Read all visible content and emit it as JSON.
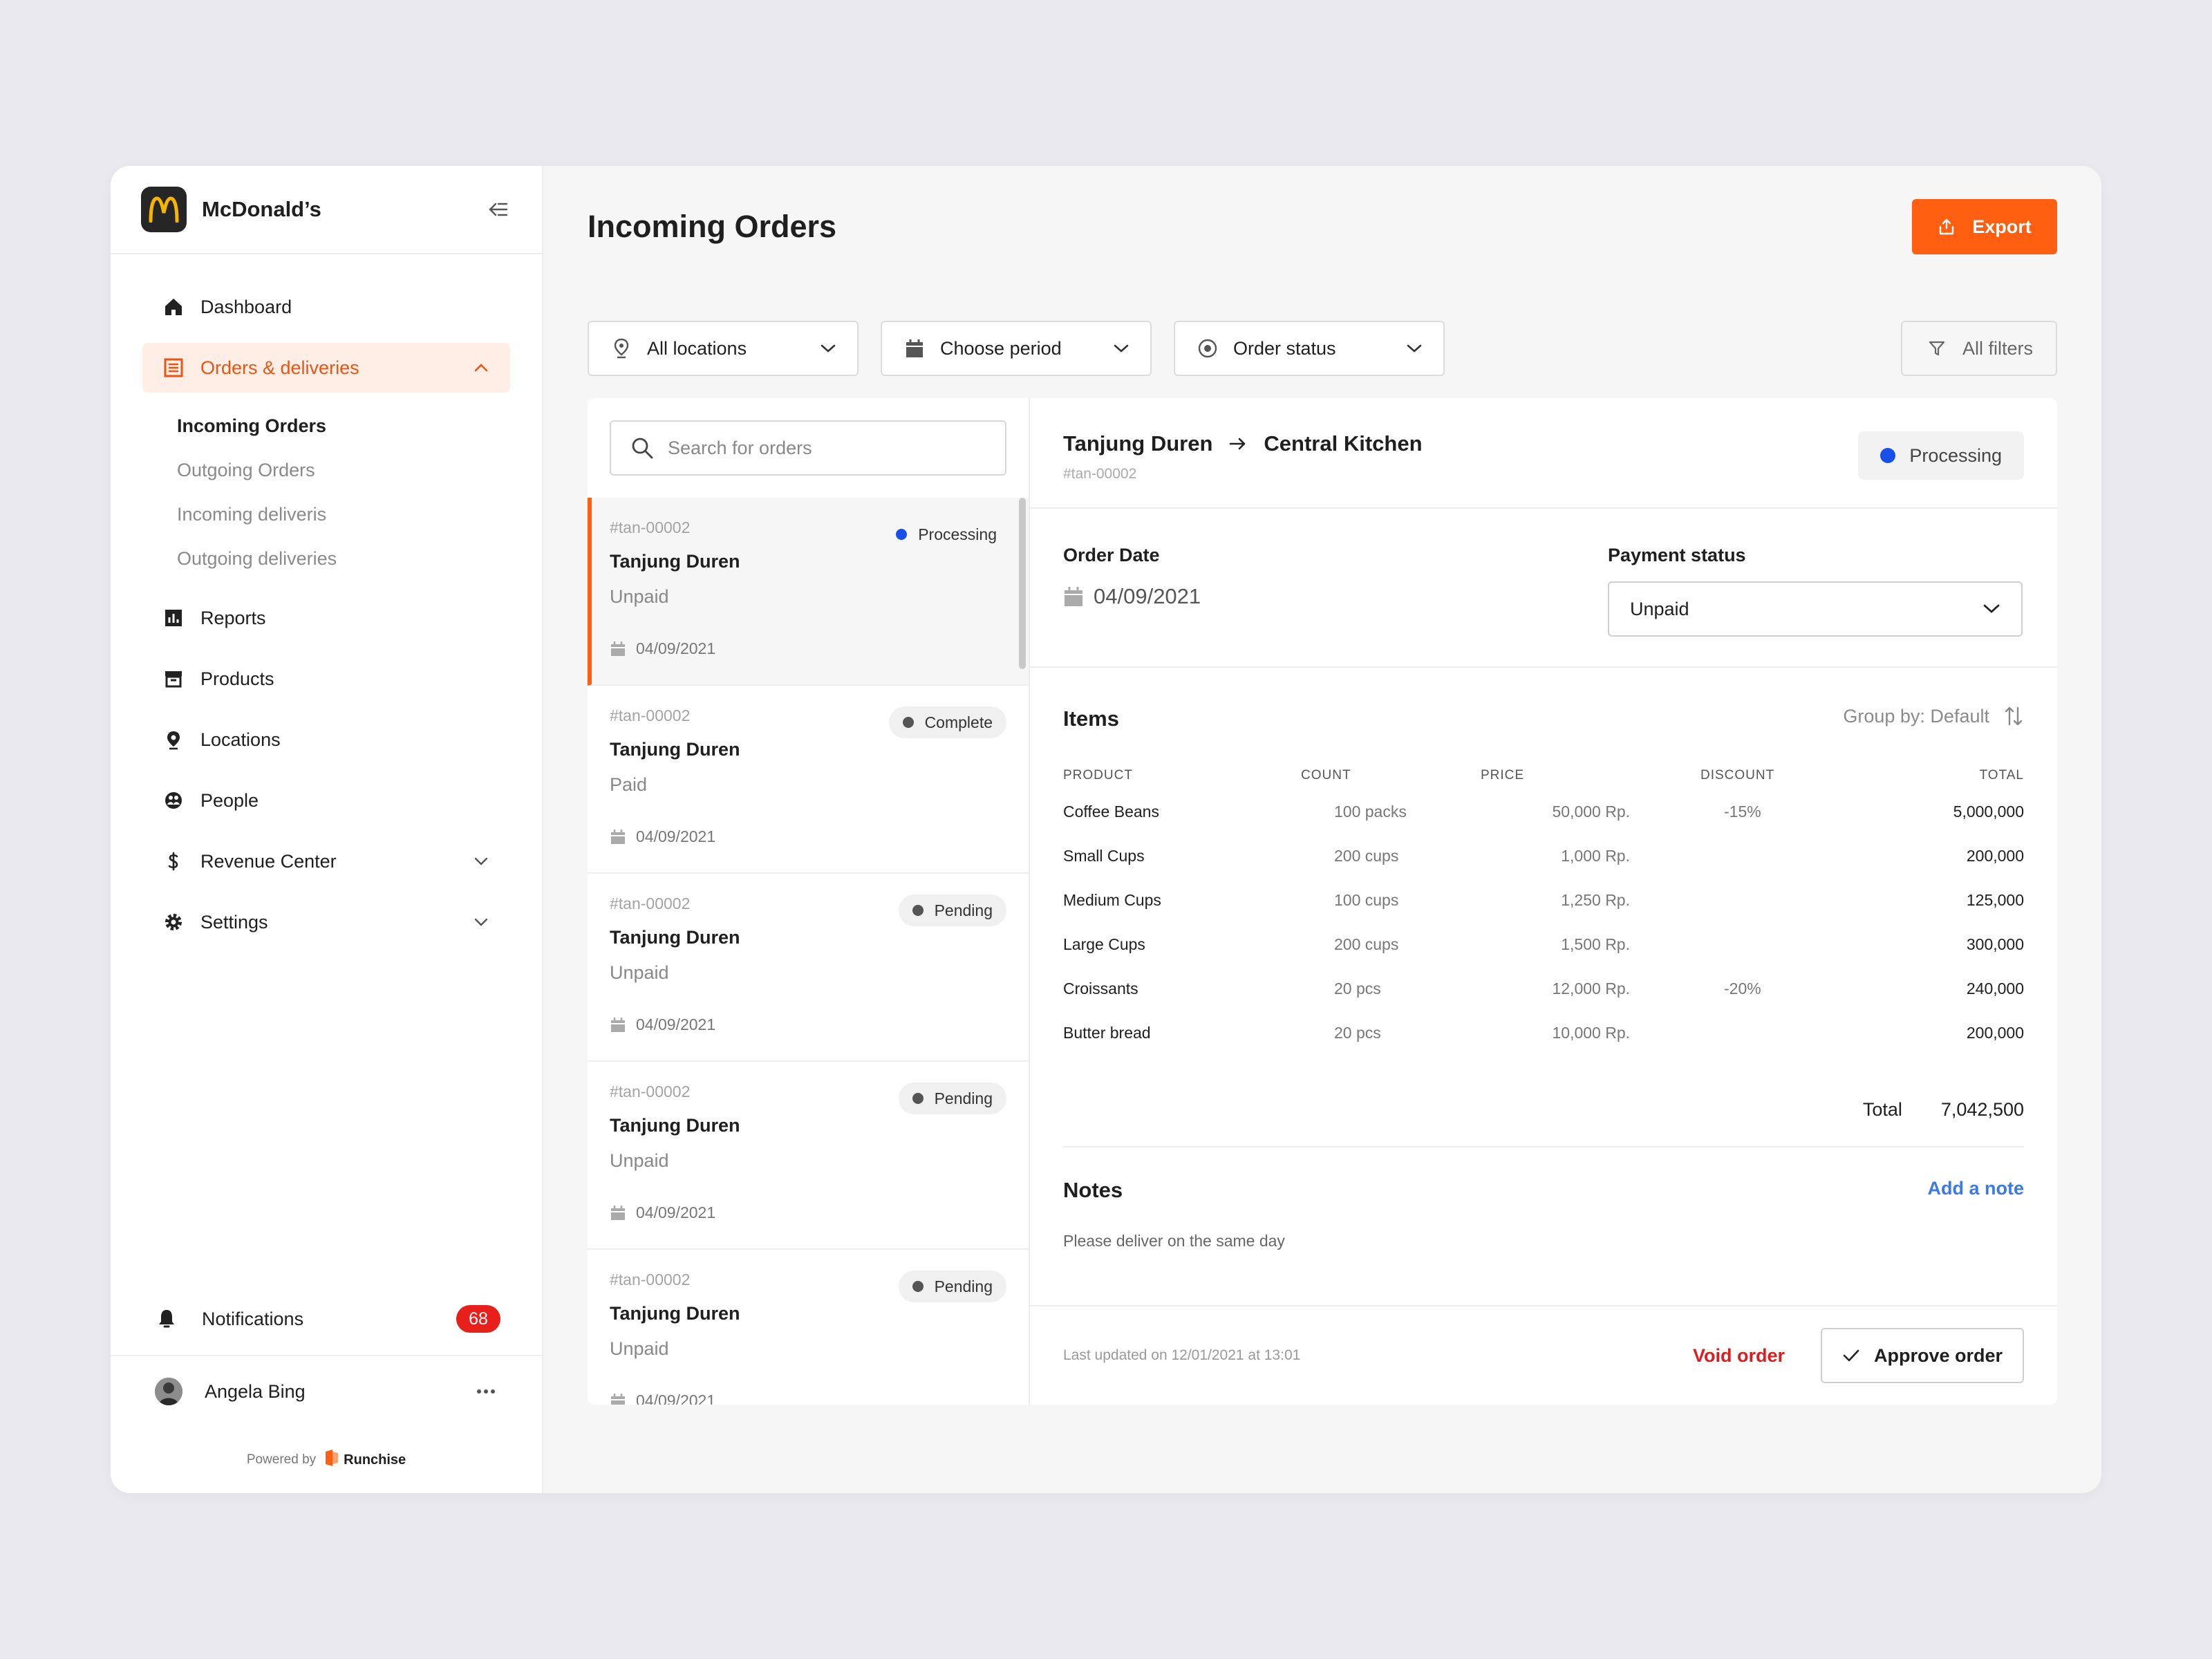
{
  "brand": {
    "name": "McDonald’s",
    "logo_glyph": "m"
  },
  "sidebar": {
    "items": [
      {
        "label": "Dashboard",
        "icon": "home-icon"
      },
      {
        "label": "Orders & deliveries",
        "icon": "list-icon",
        "active": true
      },
      {
        "label": "Reports",
        "icon": "chart-icon"
      },
      {
        "label": "Products",
        "icon": "box-icon"
      },
      {
        "label": "Locations",
        "icon": "location-icon"
      },
      {
        "label": "People",
        "icon": "people-icon"
      },
      {
        "label": "Revenue Center",
        "icon": "dollar-icon"
      },
      {
        "label": "Settings",
        "icon": "gear-icon"
      }
    ],
    "subitems": [
      "Incoming Orders",
      "Outgoing Orders",
      "Incoming deliveris",
      "Outgoing deliveries"
    ],
    "notifications": {
      "label": "Notifications",
      "count": "68"
    },
    "user": {
      "name": "Angela Bing"
    },
    "powered": {
      "prefix": "Powered by",
      "name": "Runchise"
    }
  },
  "colors": {
    "accent": "#ff5f10",
    "active_bg": "#ffeee6",
    "processing": "#1750e8",
    "danger": "#d91f1f",
    "link": "#3b7ae6"
  },
  "header": {
    "title": "Incoming Orders",
    "export_label": "Export"
  },
  "filters": {
    "location": "All locations",
    "period": "Choose period",
    "status": "Order status",
    "all": "All filters"
  },
  "list": {
    "search_placeholder": "Search for orders",
    "orders": [
      {
        "id": "#tan-00002",
        "name": "Tanjung Duren",
        "payment": "Unpaid",
        "date": "04/09/2021",
        "status": "Processing"
      },
      {
        "id": "#tan-00002",
        "name": "Tanjung Duren",
        "payment": "Paid",
        "date": "04/09/2021",
        "status": "Complete"
      },
      {
        "id": "#tan-00002",
        "name": "Tanjung Duren",
        "payment": "Unpaid",
        "date": "04/09/2021",
        "status": "Pending"
      },
      {
        "id": "#tan-00002",
        "name": "Tanjung Duren",
        "payment": "Unpaid",
        "date": "04/09/2021",
        "status": "Pending"
      },
      {
        "id": "#tan-00002",
        "name": "Tanjung Duren",
        "payment": "Unpaid",
        "date": "04/09/2021",
        "status": "Pending"
      }
    ]
  },
  "detail": {
    "from": "Tanjung Duren",
    "to": "Central Kitchen",
    "id": "#tan-00002",
    "status": "Processing",
    "order_date_label": "Order Date",
    "order_date": "04/09/2021",
    "payment_label": "Payment status",
    "payment_value": "Unpaid",
    "items_title": "Items",
    "group_by": "Group by: Default",
    "columns": [
      "PRODUCT",
      "COUNT",
      "PRICE",
      "DISCOUNT",
      "TOTAL"
    ],
    "rows": [
      {
        "product": "Coffee Beans",
        "count": "100 packs",
        "price": "50,000 Rp.",
        "discount": "-15%",
        "total": "5,000,000"
      },
      {
        "product": "Small Cups",
        "count": "200 cups",
        "price": "1,000 Rp.",
        "discount": "",
        "total": "200,000"
      },
      {
        "product": "Medium Cups",
        "count": "100 cups",
        "price": "1,250 Rp.",
        "discount": "",
        "total": "125,000"
      },
      {
        "product": "Large Cups",
        "count": "200 cups",
        "price": "1,500 Rp.",
        "discount": "",
        "total": "300,000"
      },
      {
        "product": "Croissants",
        "count": "20 pcs",
        "price": "12,000 Rp.",
        "discount": "-20%",
        "total": "240,000"
      },
      {
        "product": "Butter bread",
        "count": "20 pcs",
        "price": "10,000 Rp.",
        "discount": "",
        "total": "200,000"
      }
    ],
    "total_label": "Total",
    "total_value": "7,042,500",
    "notes_title": "Notes",
    "add_note": "Add a note",
    "notes_text": "Please deliver on the same day",
    "updated": "Last updated on 12/01/2021 at 13:01",
    "void_label": "Void order",
    "approve_label": "Approve order"
  }
}
